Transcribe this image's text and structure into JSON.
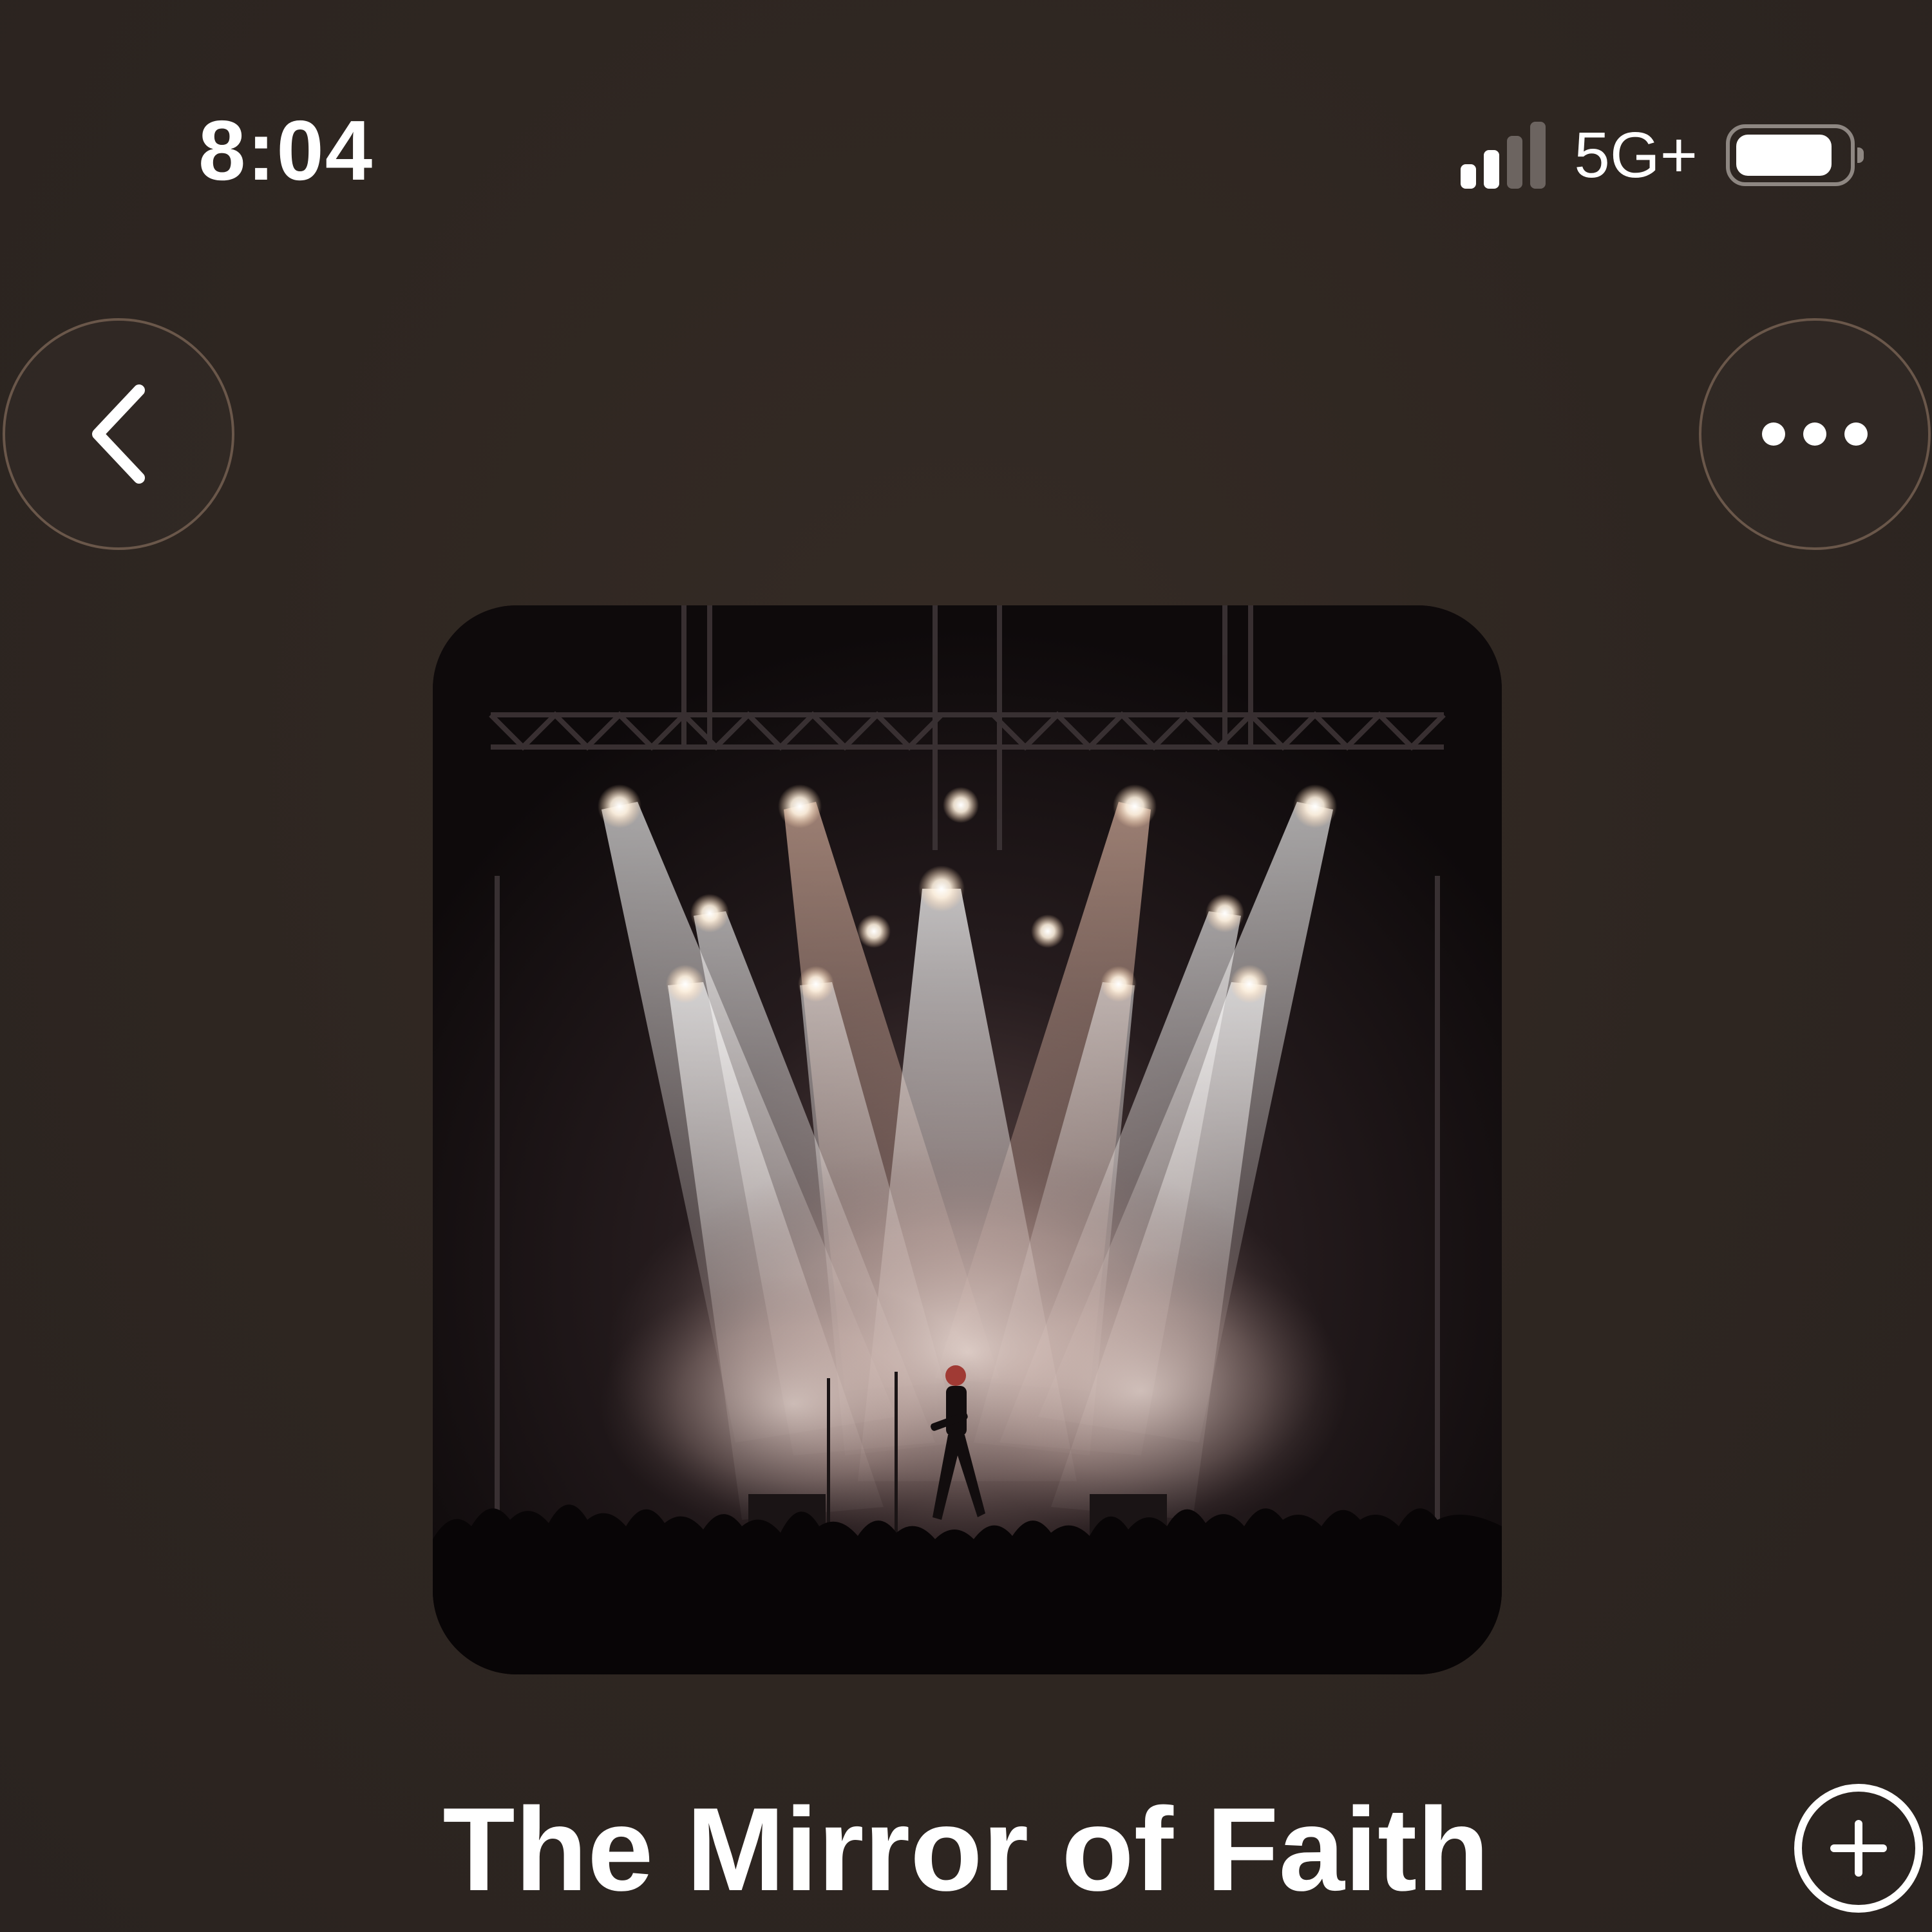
{
  "status_bar": {
    "time": "8:04",
    "network": "5G+",
    "signal_bars_filled": 2,
    "signal_bars_total": 4,
    "battery_icon": "battery-icon"
  },
  "nav": {
    "back_icon": "chevron-left-icon",
    "more_icon": "ellipsis-icon"
  },
  "album": {
    "artwork_subject": "concert-stage-artwork"
  },
  "song": {
    "title": "The Mirror of Faith",
    "add_icon": "plus-circle-icon"
  },
  "colors": {
    "background": "#2e2621",
    "nav_border": "#6a574a",
    "text": "#ffffff"
  }
}
